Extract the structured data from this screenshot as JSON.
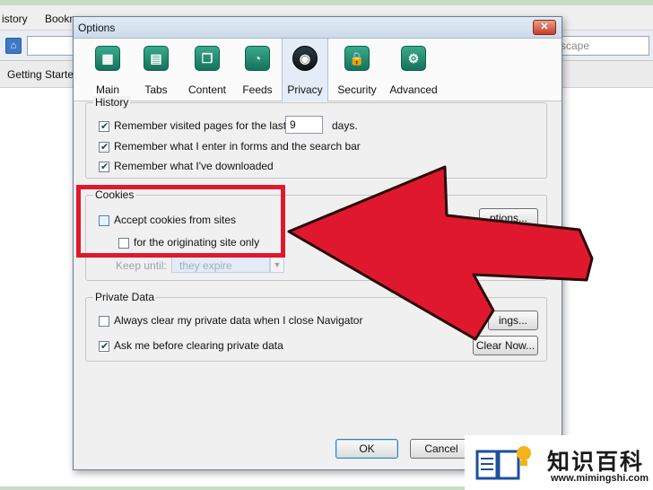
{
  "background": {
    "menu": [
      "istory",
      "Bookm"
    ],
    "search_placeholder": "scape",
    "bookmark": "Getting Starte"
  },
  "dialog": {
    "title": "Options",
    "tabs": [
      {
        "label": "Main",
        "icon": "main-icon"
      },
      {
        "label": "Tabs",
        "icon": "tabs-icon"
      },
      {
        "label": "Content",
        "icon": "content-icon"
      },
      {
        "label": "Feeds",
        "icon": "feeds-icon"
      },
      {
        "label": "Privacy",
        "icon": "privacy-icon",
        "selected": true
      },
      {
        "label": "Security",
        "icon": "security-icon"
      },
      {
        "label": "Advanced",
        "icon": "advanced-icon"
      }
    ],
    "history": {
      "title": "History",
      "remember_visited_pre": "Remember visited pages for the last",
      "days_value": "9",
      "days_label": "days.",
      "remember_forms": "Remember what I enter in forms and the search bar",
      "remember_downloads": "Remember what I've downloaded"
    },
    "cookies": {
      "title": "Cookies",
      "accept": "Accept cookies from sites",
      "originating": "for the originating site only",
      "exceptions_button": "ptions...",
      "keep_until_label": "Keep until:",
      "keep_until_value": "they expire"
    },
    "private_data": {
      "title": "Private Data",
      "always_clear": "Always clear my private data when I close Navigator",
      "ask_me": "Ask me before clearing private data",
      "settings_button": "ings...",
      "clear_now_button": "Clear Now..."
    },
    "ok_button": "OK",
    "cancel_button": "Cancel"
  },
  "watermark": {
    "text": "知识百科",
    "url": "www.mimingshi.com"
  },
  "colors": {
    "arrow": "#e0182e",
    "highlight": "#e0182e",
    "tab_icon": "#1f8a6e"
  }
}
